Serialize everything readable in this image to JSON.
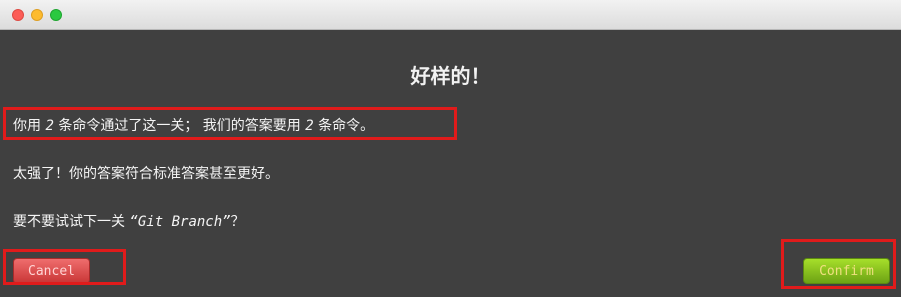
{
  "dialog": {
    "title": "好样的！",
    "result_prefix": "你用 ",
    "user_commands": "2",
    "result_middle": " 条命令通过了这一关； 我们的答案要用 ",
    "answer_commands": "2",
    "result_suffix": " 条命令。",
    "praise": "太强了！你的答案符合标准答案甚至更好。",
    "next_prefix": "要不要试试下一关 ",
    "next_level": "“Git Branch”",
    "next_suffix": "？"
  },
  "buttons": {
    "cancel_label": "Cancel",
    "confirm_label": "Confirm"
  },
  "colors": {
    "highlight": "#e01b1b",
    "cancel": "#d94a4a",
    "confirm": "#8bc220"
  }
}
